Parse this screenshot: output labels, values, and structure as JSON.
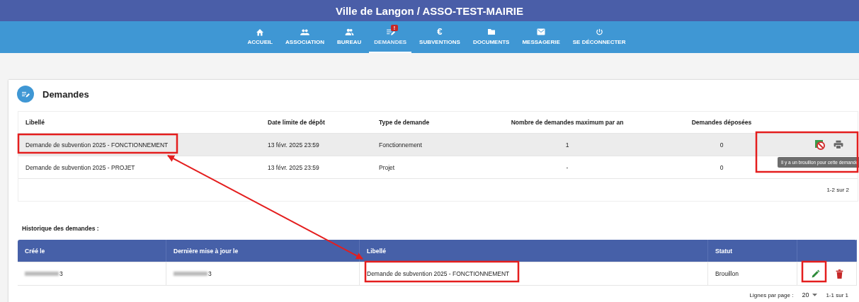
{
  "window": {
    "title": "Ville de Langon / ASSO-TEST-MAIRIE"
  },
  "nav": [
    {
      "label": "ACCUEIL",
      "selected": false
    },
    {
      "label": "ASSOCIATION",
      "selected": false
    },
    {
      "label": "BUREAU",
      "selected": false
    },
    {
      "label": "DEMANDES",
      "selected": true,
      "badge": "!"
    },
    {
      "glyph": "€",
      "label": "SUBVENTIONS",
      "selected": false
    },
    {
      "label": "DOCUMENTS",
      "selected": false
    },
    {
      "label": "MESSAGERIE",
      "selected": false
    },
    {
      "label": "SE DÉCONNECTER",
      "selected": false
    }
  ],
  "demandes": {
    "title": "Demandes",
    "columns": [
      "Libellé",
      "Date limite de dépôt",
      "Type de demande",
      "Nombre de demandes maximum par an",
      "Demandes déposées"
    ],
    "rows": [
      {
        "cells": [
          "Demande de subvention 2025 - FONCTIONNEMENT",
          "13 févr. 2025 23:59",
          "Fonctionnement",
          "1",
          "0"
        ],
        "selected": true,
        "draft": true
      },
      {
        "cells": [
          "Demande de subvention 2025 - PROJET",
          "13 févr. 2025 23:59",
          "Projet",
          "-",
          "0"
        ],
        "selected": false,
        "draft": false
      }
    ],
    "tooltip": "Il y a un brouillon pour cette demande",
    "range": "1-2 sur 2"
  },
  "historique": {
    "title": "Historique des demandes :",
    "columns": [
      {
        "label": "Créé le",
        "redacted": true
      },
      {
        "label": "Dernière mise à jour le",
        "redacted": true
      },
      {
        "label": "Libellé",
        "redacted": false
      },
      {
        "label": "Statut",
        "redacted": false
      }
    ],
    "rows": [
      {
        "cells": [
          "3",
          "3",
          "Demande de subvention 2025 - FONCTIONNEMENT",
          "Brouillon"
        ]
      }
    ],
    "rows_per_page_label": "Lignes par page :",
    "rows_per_page": "20",
    "range": "1-1 sur 1"
  }
}
